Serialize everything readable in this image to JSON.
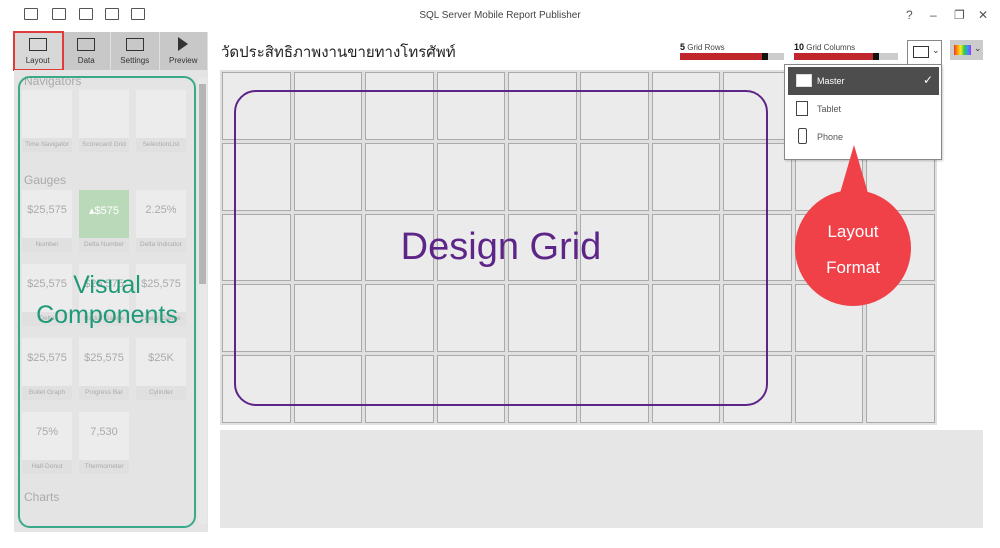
{
  "window": {
    "title": "SQL Server Mobile Report Publisher",
    "help": "?",
    "minimize": "–",
    "restore": "❐",
    "close": "✕"
  },
  "ribbon": {
    "tabs": [
      {
        "label": "Layout",
        "icon": "layout-icon",
        "active": true
      },
      {
        "label": "Data",
        "icon": "data-icon"
      },
      {
        "label": "Settings",
        "icon": "settings-icon"
      },
      {
        "label": "Preview",
        "icon": "preview-icon"
      }
    ]
  },
  "gallery": {
    "sections": {
      "navigators": "Navigators",
      "gauges": "Gauges",
      "charts": "Charts"
    },
    "navigators": [
      "Time Navigator",
      "Scorecard Grid",
      "SelectionList"
    ],
    "gauges": [
      {
        "label": "Number",
        "value": "$25,575"
      },
      {
        "label": "Delta Number",
        "value": "▴$575"
      },
      {
        "label": "Delta Indicator",
        "value": "2.25%"
      },
      {
        "label": "Delta",
        "value": "$25,575"
      },
      {
        "label": "Radial Gauge",
        "value": "$25,575"
      },
      {
        "label": "Linear Gauge",
        "value": "$25,575"
      },
      {
        "label": "Bullet Graph",
        "value": "$25,575"
      },
      {
        "label": "Progress Bar",
        "value": "$25,575"
      },
      {
        "label": "Cylinder",
        "value": "$25K"
      },
      {
        "label": "Half-Donut",
        "value": "75%"
      },
      {
        "label": "Thermometer",
        "value": "7,530"
      }
    ]
  },
  "report": {
    "title": "วัดประสิทธิภาพงานขายทางโทรศัพท์"
  },
  "grid_controls": {
    "rows": {
      "value": "5",
      "label": "Grid Rows",
      "fraction": 0.85
    },
    "columns": {
      "value": "10",
      "label": "Grid Columns",
      "fraction": 0.82
    }
  },
  "layout_menu": {
    "items": [
      {
        "label": "Master",
        "selected": true
      },
      {
        "label": "Tablet"
      },
      {
        "label": "Phone"
      }
    ],
    "check": "✓",
    "chevron": "⌄"
  },
  "annotations": {
    "design_grid": "Design Grid",
    "visual_components_1": "Visual",
    "visual_components_2": "Components",
    "layout_format_1": "Layout",
    "layout_format_2": "Format"
  },
  "colors": {
    "accent_red": "#c0272d",
    "annotation_purple": "#5e2588",
    "annotation_teal": "#1f9a78",
    "callout": "#f04149"
  }
}
